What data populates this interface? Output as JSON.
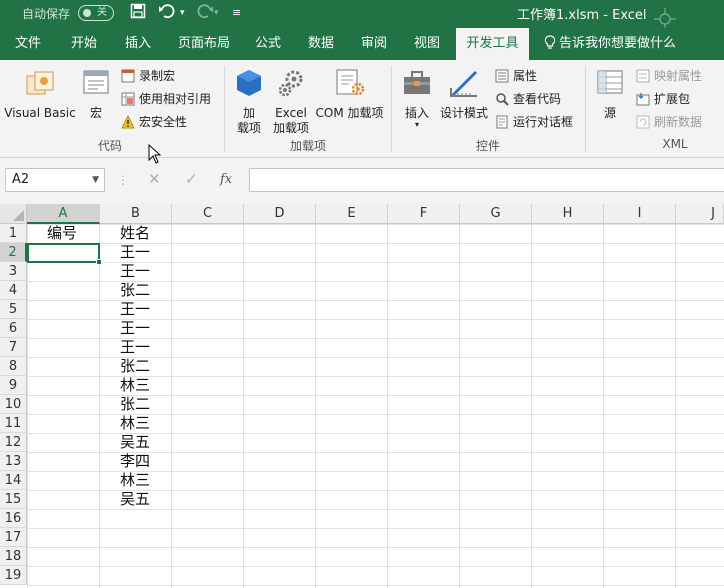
{
  "titlebar": {
    "autosave_label": "自动保存",
    "toggle_label": "关",
    "doc_title": "工作簿1.xlsm  -  Excel"
  },
  "tabs": [
    {
      "label": "文件"
    },
    {
      "label": "开始"
    },
    {
      "label": "插入"
    },
    {
      "label": "页面布局"
    },
    {
      "label": "公式"
    },
    {
      "label": "数据"
    },
    {
      "label": "审阅"
    },
    {
      "label": "视图"
    },
    {
      "label": "开发工具",
      "active": true
    }
  ],
  "tellme": "告诉我你想要做什么",
  "ribbon": {
    "code": {
      "group_label": "代码",
      "visual_basic": "Visual Basic",
      "macro": "宏",
      "record_macro": "录制宏",
      "relative_ref": "使用相对引用",
      "macro_security": "宏安全性"
    },
    "addins": {
      "group_label": "加载项",
      "addin_line1": "加",
      "addin_line2": "载项",
      "excel_line1": "Excel",
      "excel_line2": "加载项",
      "com_addins": "COM 加载项"
    },
    "controls": {
      "group_label": "控件",
      "insert": "插入",
      "design_mode": "设计模式",
      "properties": "属性",
      "view_code": "查看代码",
      "run_dialog": "运行对话框"
    },
    "xml": {
      "group_label": "XML",
      "source": "源",
      "map_properties": "映射属性",
      "expansion_packs": "扩展包",
      "refresh_data": "刷新数据"
    }
  },
  "formula_bar": {
    "name_box": "A2",
    "fx": "fx"
  },
  "grid": {
    "columns": [
      "A",
      "B",
      "C",
      "D",
      "E",
      "F",
      "G",
      "H",
      "I",
      "J"
    ],
    "selected_column": "A",
    "rows": [
      "1",
      "2",
      "3",
      "4",
      "5",
      "6",
      "7",
      "8",
      "9",
      "10",
      "11",
      "12",
      "13",
      "14",
      "15",
      "16",
      "17",
      "18",
      "19"
    ],
    "selected_row": "2",
    "header_a": "编号",
    "header_b": "姓名",
    "names": [
      "王一",
      "王一",
      "张二",
      "王一",
      "王一",
      "王一",
      "张二",
      "林三",
      "张二",
      "林三",
      "吴五",
      "李四",
      "林三",
      "吴五"
    ]
  },
  "colors": {
    "accent": "#217346"
  }
}
